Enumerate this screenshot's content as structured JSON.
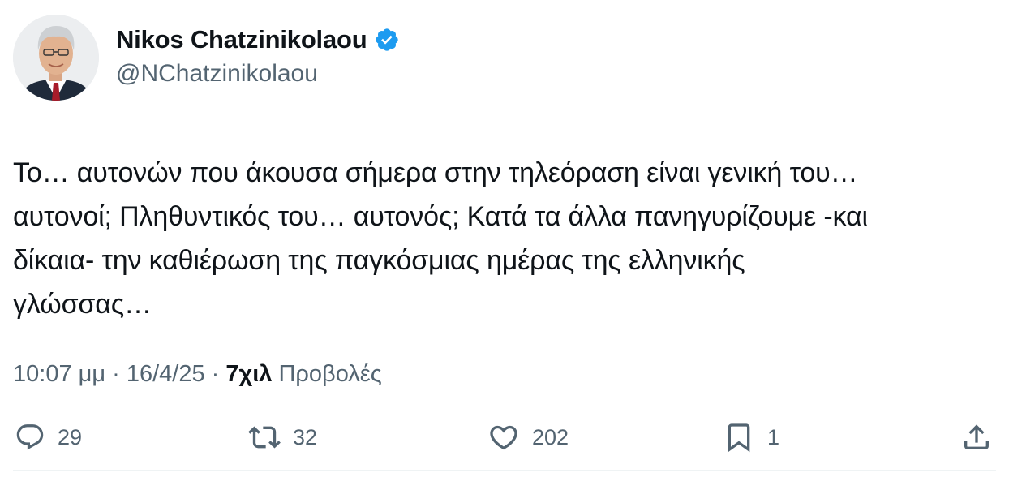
{
  "author": {
    "display_name": "Nikos Chatzinikolaou",
    "handle": "@NChatzinikolaou",
    "avatar_icon": "profile-photo",
    "verified_icon": "verified-badge-icon",
    "verified_color": "#1d9bf0"
  },
  "tweet": {
    "lines": [
      "Το… αυτονών που άκουσα σήμερα στην τηλεόραση είναι γενική του…",
      "αυτονοί; Πληθυντικός του… αυτονός; Κατά τα άλλα πανηγυρίζουμε -και",
      "δίκαια- την καθιέρωση της παγκόσμιας ημέρας της ελληνικής",
      "γλώσσας…"
    ]
  },
  "meta": {
    "time": "10:07 μμ",
    "separator": " · ",
    "date": "16/4/25",
    "views_count": "7χιλ",
    "views_label": "Προβολές"
  },
  "actions": {
    "replies": {
      "icon": "reply-icon",
      "count": "29"
    },
    "retweets": {
      "icon": "retweet-icon",
      "count": "32"
    },
    "likes": {
      "icon": "heart-icon",
      "count": "202"
    },
    "bookmarks": {
      "icon": "bookmark-icon",
      "count": "1"
    },
    "share": {
      "icon": "share-icon"
    }
  },
  "colors": {
    "text_primary": "#0f1419",
    "text_secondary": "#536471",
    "accent": "#1d9bf0",
    "divider": "#eff3f4"
  }
}
